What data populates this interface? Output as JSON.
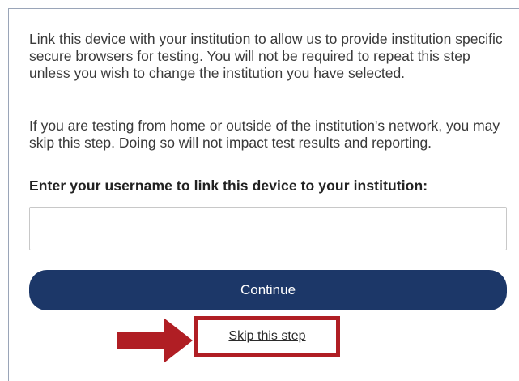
{
  "instructions": {
    "paragraph_1": "Link this device with your institution to allow us to provide institution specific secure browsers for testing. You will not be required to repeat this step unless you wish to change the institution you have selected.",
    "paragraph_2": "If you are testing from home or outside of the institution's network, you may skip this step. Doing so will not impact test results and reporting."
  },
  "form": {
    "username_label": "Enter your username to link this device to your institution:",
    "username_value": "",
    "continue_label": "Continue",
    "skip_label": "Skip this step"
  },
  "annotation": {
    "arrow_icon": "right-arrow-icon",
    "highlight_color": "#b01e24"
  },
  "colors": {
    "button_bg": "#1c3768",
    "button_text": "#ffffff",
    "highlight": "#b01e24"
  }
}
